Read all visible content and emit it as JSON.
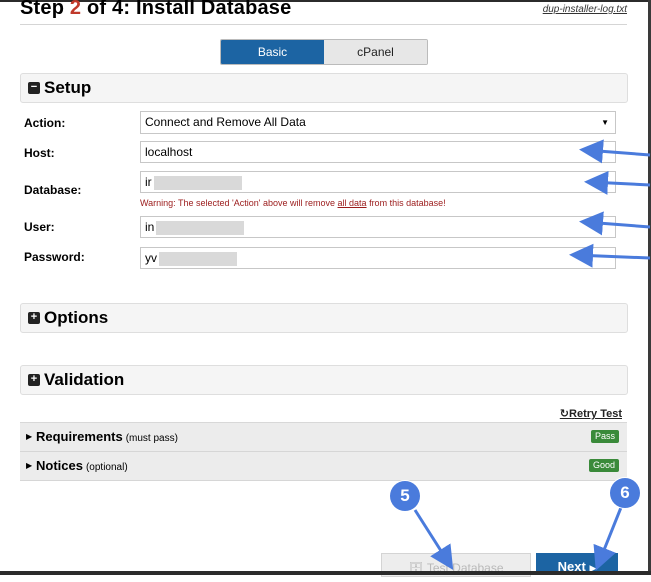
{
  "header": {
    "title_prefix": "Step ",
    "step_number": "2",
    "title_suffix": " of 4: Install Database",
    "log_link": "dup-installer-log.txt"
  },
  "tabs": [
    {
      "label": "Basic",
      "active": true
    },
    {
      "label": "cPanel",
      "active": false
    }
  ],
  "setup": {
    "section_title": "Setup",
    "action": {
      "label": "Action:",
      "value": "Connect and Remove All Data"
    },
    "host": {
      "label": "Host:",
      "value": "localhost"
    },
    "database": {
      "label": "Database:",
      "value": "ir"
    },
    "warning_prefix": "Warning: The selected 'Action' above will remove ",
    "warning_link": "all data",
    "warning_suffix": " from this database!",
    "user": {
      "label": "User:",
      "value": "in"
    },
    "password": {
      "label": "Password:",
      "value": "yv"
    }
  },
  "options": {
    "section_title": "Options"
  },
  "validation": {
    "section_title": "Validation",
    "retry_label": "Retry Test",
    "requirements": {
      "name": "Requirements",
      "note": "(must pass)",
      "status": "Pass"
    },
    "notices": {
      "name": "Notices",
      "note": "(optional)",
      "status": "Good"
    }
  },
  "buttons": {
    "test_database": "Test Database",
    "next": "Next"
  },
  "markers": [
    "5",
    "6"
  ],
  "colors": {
    "accent": "#1c64a3",
    "step_number": "#c0392b",
    "annotation_arrow": "#4a7bdc",
    "badge_green": "#3a8a3a",
    "warning": "#9b1b1b"
  },
  "icons": {
    "setup": "minus-square-icon",
    "options": "plus-square-icon",
    "validation": "plus-square-icon",
    "retry": "refresh-icon",
    "test": "database-icon",
    "next": "caret-right-icon"
  }
}
